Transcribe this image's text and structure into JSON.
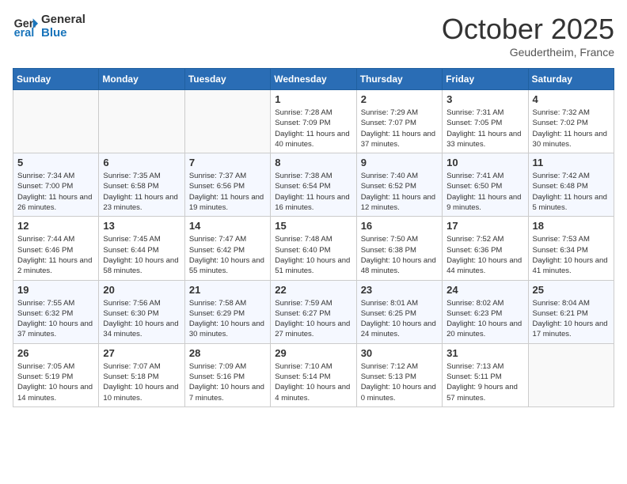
{
  "header": {
    "logo_line1": "General",
    "logo_line2": "Blue",
    "month": "October 2025",
    "location": "Geudertheim, France"
  },
  "weekdays": [
    "Sunday",
    "Monday",
    "Tuesday",
    "Wednesday",
    "Thursday",
    "Friday",
    "Saturday"
  ],
  "weeks": [
    [
      {
        "day": "",
        "info": ""
      },
      {
        "day": "",
        "info": ""
      },
      {
        "day": "",
        "info": ""
      },
      {
        "day": "1",
        "info": "Sunrise: 7:28 AM\nSunset: 7:09 PM\nDaylight: 11 hours and 40 minutes."
      },
      {
        "day": "2",
        "info": "Sunrise: 7:29 AM\nSunset: 7:07 PM\nDaylight: 11 hours and 37 minutes."
      },
      {
        "day": "3",
        "info": "Sunrise: 7:31 AM\nSunset: 7:05 PM\nDaylight: 11 hours and 33 minutes."
      },
      {
        "day": "4",
        "info": "Sunrise: 7:32 AM\nSunset: 7:02 PM\nDaylight: 11 hours and 30 minutes."
      }
    ],
    [
      {
        "day": "5",
        "info": "Sunrise: 7:34 AM\nSunset: 7:00 PM\nDaylight: 11 hours and 26 minutes."
      },
      {
        "day": "6",
        "info": "Sunrise: 7:35 AM\nSunset: 6:58 PM\nDaylight: 11 hours and 23 minutes."
      },
      {
        "day": "7",
        "info": "Sunrise: 7:37 AM\nSunset: 6:56 PM\nDaylight: 11 hours and 19 minutes."
      },
      {
        "day": "8",
        "info": "Sunrise: 7:38 AM\nSunset: 6:54 PM\nDaylight: 11 hours and 16 minutes."
      },
      {
        "day": "9",
        "info": "Sunrise: 7:40 AM\nSunset: 6:52 PM\nDaylight: 11 hours and 12 minutes."
      },
      {
        "day": "10",
        "info": "Sunrise: 7:41 AM\nSunset: 6:50 PM\nDaylight: 11 hours and 9 minutes."
      },
      {
        "day": "11",
        "info": "Sunrise: 7:42 AM\nSunset: 6:48 PM\nDaylight: 11 hours and 5 minutes."
      }
    ],
    [
      {
        "day": "12",
        "info": "Sunrise: 7:44 AM\nSunset: 6:46 PM\nDaylight: 11 hours and 2 minutes."
      },
      {
        "day": "13",
        "info": "Sunrise: 7:45 AM\nSunset: 6:44 PM\nDaylight: 10 hours and 58 minutes."
      },
      {
        "day": "14",
        "info": "Sunrise: 7:47 AM\nSunset: 6:42 PM\nDaylight: 10 hours and 55 minutes."
      },
      {
        "day": "15",
        "info": "Sunrise: 7:48 AM\nSunset: 6:40 PM\nDaylight: 10 hours and 51 minutes."
      },
      {
        "day": "16",
        "info": "Sunrise: 7:50 AM\nSunset: 6:38 PM\nDaylight: 10 hours and 48 minutes."
      },
      {
        "day": "17",
        "info": "Sunrise: 7:52 AM\nSunset: 6:36 PM\nDaylight: 10 hours and 44 minutes."
      },
      {
        "day": "18",
        "info": "Sunrise: 7:53 AM\nSunset: 6:34 PM\nDaylight: 10 hours and 41 minutes."
      }
    ],
    [
      {
        "day": "19",
        "info": "Sunrise: 7:55 AM\nSunset: 6:32 PM\nDaylight: 10 hours and 37 minutes."
      },
      {
        "day": "20",
        "info": "Sunrise: 7:56 AM\nSunset: 6:30 PM\nDaylight: 10 hours and 34 minutes."
      },
      {
        "day": "21",
        "info": "Sunrise: 7:58 AM\nSunset: 6:29 PM\nDaylight: 10 hours and 30 minutes."
      },
      {
        "day": "22",
        "info": "Sunrise: 7:59 AM\nSunset: 6:27 PM\nDaylight: 10 hours and 27 minutes."
      },
      {
        "day": "23",
        "info": "Sunrise: 8:01 AM\nSunset: 6:25 PM\nDaylight: 10 hours and 24 minutes."
      },
      {
        "day": "24",
        "info": "Sunrise: 8:02 AM\nSunset: 6:23 PM\nDaylight: 10 hours and 20 minutes."
      },
      {
        "day": "25",
        "info": "Sunrise: 8:04 AM\nSunset: 6:21 PM\nDaylight: 10 hours and 17 minutes."
      }
    ],
    [
      {
        "day": "26",
        "info": "Sunrise: 7:05 AM\nSunset: 5:19 PM\nDaylight: 10 hours and 14 minutes."
      },
      {
        "day": "27",
        "info": "Sunrise: 7:07 AM\nSunset: 5:18 PM\nDaylight: 10 hours and 10 minutes."
      },
      {
        "day": "28",
        "info": "Sunrise: 7:09 AM\nSunset: 5:16 PM\nDaylight: 10 hours and 7 minutes."
      },
      {
        "day": "29",
        "info": "Sunrise: 7:10 AM\nSunset: 5:14 PM\nDaylight: 10 hours and 4 minutes."
      },
      {
        "day": "30",
        "info": "Sunrise: 7:12 AM\nSunset: 5:13 PM\nDaylight: 10 hours and 0 minutes."
      },
      {
        "day": "31",
        "info": "Sunrise: 7:13 AM\nSunset: 5:11 PM\nDaylight: 9 hours and 57 minutes."
      },
      {
        "day": "",
        "info": ""
      }
    ]
  ]
}
